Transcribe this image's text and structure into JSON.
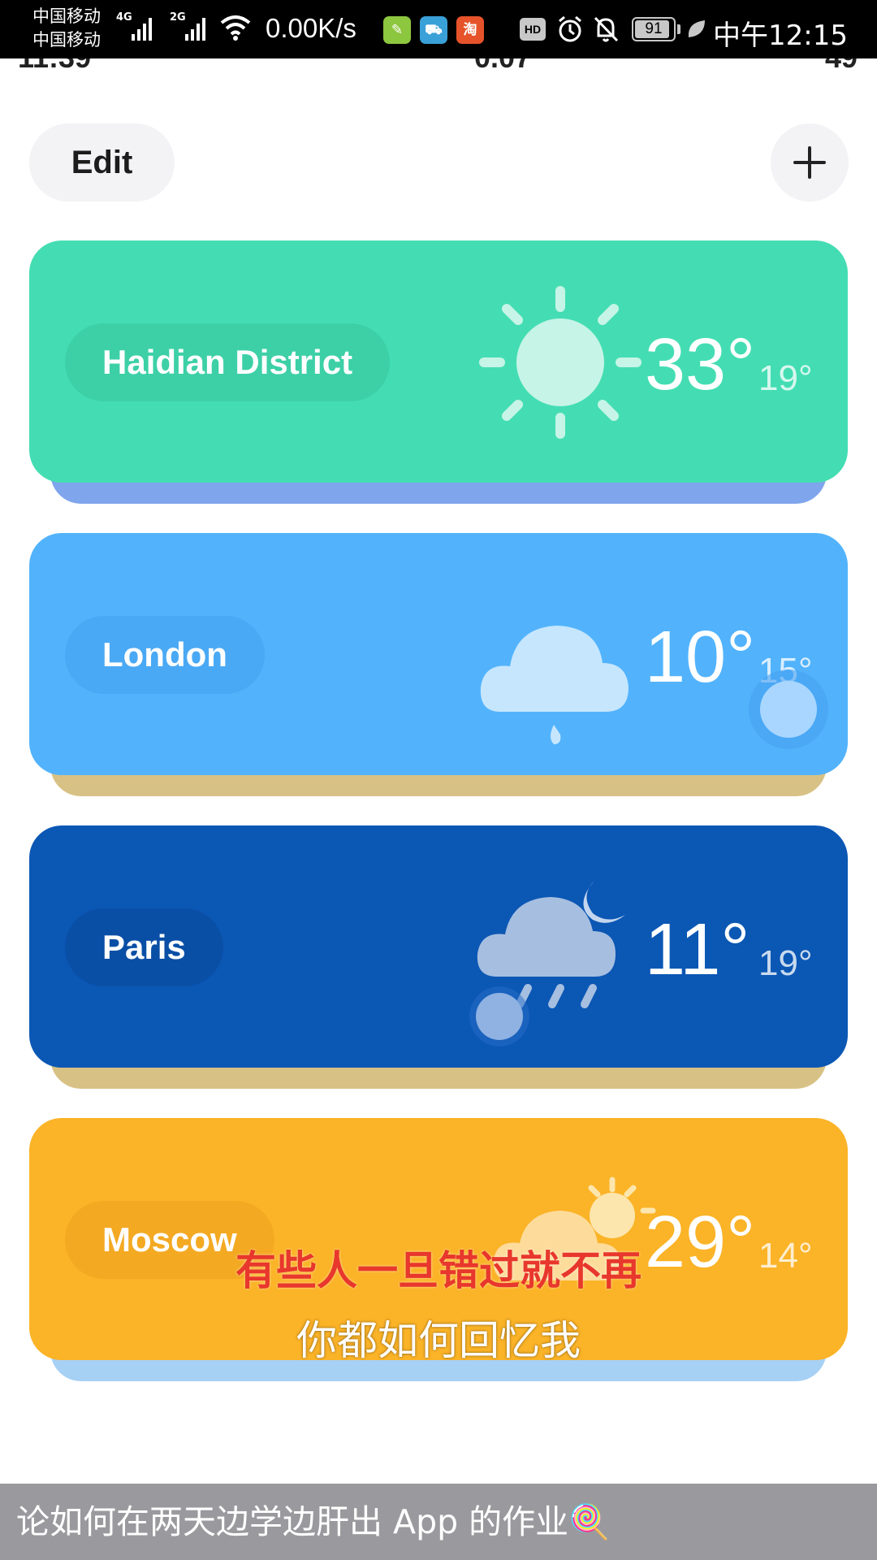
{
  "status_bar": {
    "carrier_1": "中国移动",
    "carrier_2": "中国移动",
    "net_1": "4G",
    "net_2": "2G",
    "speed": "0.00K/s",
    "app_icons": [
      {
        "name": "notes-app-icon",
        "glyph": "✎",
        "color": "#8dc63f"
      },
      {
        "name": "delivery-app-icon",
        "glyph": "⛟",
        "color": "#3aa0d8"
      },
      {
        "name": "taobao-app-icon",
        "glyph": "淘",
        "color": "#e6532a"
      }
    ],
    "hd_label": "HD",
    "battery": "91",
    "battery_level": 0.91,
    "time": "中午12:15"
  },
  "inner_status": {
    "time": "11:39",
    "speed": "0.07",
    "battery": "49"
  },
  "header": {
    "edit_label": "Edit",
    "add_label": "+"
  },
  "cities": [
    {
      "name": "Haidian District",
      "temp": "33°",
      "low": "19°",
      "icon": "sun-icon",
      "color": "#44ddb3",
      "pill": "#3dd0a7",
      "back": "#7fa5ec"
    },
    {
      "name": "London",
      "temp": "10°",
      "low": "15°",
      "icon": "cloud-rain-icon",
      "color": "#52b3fc",
      "pill": "#4aa9f4",
      "back": "#d8c184"
    },
    {
      "name": "Paris",
      "temp": "11°",
      "low": "19°",
      "icon": "night-rain-icon",
      "color": "#0b57b4",
      "pill": "#0a4fa6",
      "back": "#d8c184"
    },
    {
      "name": "Moscow",
      "temp": "29°",
      "low": "14°",
      "icon": "partly-sunny-icon",
      "color": "#fbb327",
      "pill": "#f4a922",
      "back": "#a7d0f5"
    }
  ],
  "subtitles": {
    "line_1": "有些人一旦错过就不再",
    "line_2": "你都如何回忆我"
  },
  "caption": {
    "text": "论如何在两天边学边肝出 App 的作业🍭"
  }
}
